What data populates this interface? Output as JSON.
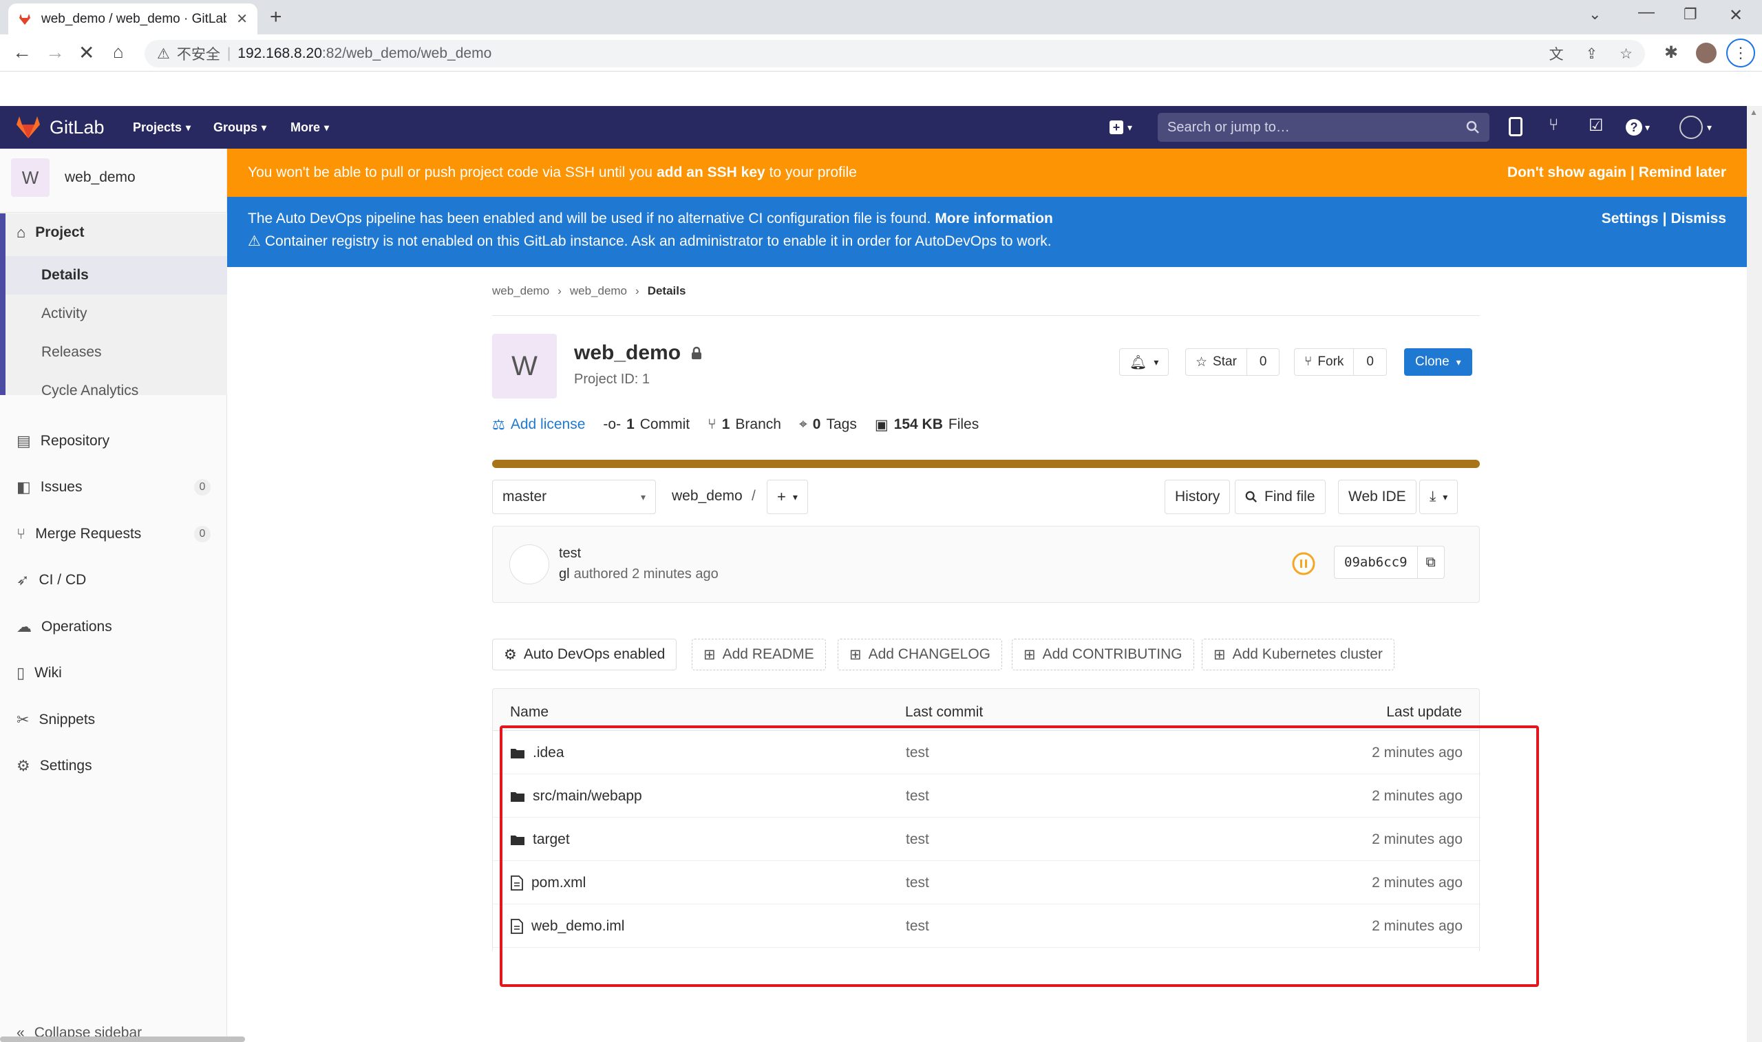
{
  "browser": {
    "tab_title": "web_demo / web_demo · GitLab",
    "security_label": "不安全",
    "url_host": "192.168.8.20",
    "url_rest": ":82/web_demo/web_demo"
  },
  "header": {
    "brand": "GitLab",
    "nav": [
      "Projects",
      "Groups",
      "More"
    ],
    "search_placeholder": "Search or jump to…"
  },
  "sidebar": {
    "project_initial": "W",
    "project_name": "web_demo",
    "section": "Project",
    "sub_items": [
      "Details",
      "Activity",
      "Releases",
      "Cycle Analytics"
    ],
    "items": [
      {
        "label": "Repository"
      },
      {
        "label": "Issues",
        "count": "0"
      },
      {
        "label": "Merge Requests",
        "count": "0"
      },
      {
        "label": "CI / CD"
      },
      {
        "label": "Operations"
      },
      {
        "label": "Wiki"
      },
      {
        "label": "Snippets"
      },
      {
        "label": "Settings"
      }
    ],
    "collapse": "Collapse sidebar"
  },
  "banners": {
    "ssh_text": "You won't be able to pull or push project code via SSH until you",
    "ssh_link": "add an SSH key",
    "ssh_tail": "to your profile",
    "dont_show": "Don't show again",
    "remind": "Remind later",
    "devops_text": "The Auto DevOps pipeline has been enabled and will be used if no alternative CI configuration file is found.",
    "devops_link": "More information",
    "registry_text": "Container registry is not enabled on this GitLab instance. Ask an administrator to enable it in order for AutoDevOps to work.",
    "settings": "Settings",
    "dismiss": "Dismiss"
  },
  "breadcrumb": [
    "web_demo",
    "web_demo",
    "Details"
  ],
  "project": {
    "initial": "W",
    "name": "web_demo",
    "id_label": "Project ID: 1",
    "star_label": "Star",
    "star_count": "0",
    "fork_label": "Fork",
    "fork_count": "0",
    "clone_label": "Clone"
  },
  "stats": {
    "add_license": "Add license",
    "commits_num": "1",
    "commits_label": "Commit",
    "branches_num": "1",
    "branches_label": "Branch",
    "tags_num": "0",
    "tags_label": "Tags",
    "size_num": "154 KB",
    "size_label": "Files"
  },
  "repo": {
    "branch": "master",
    "path": "web_demo",
    "sep": "/",
    "history": "History",
    "find_file": "Find file",
    "web_ide": "Web IDE"
  },
  "commit": {
    "message": "test",
    "author": "gl",
    "authored": "authored 2 minutes ago",
    "sha": "09ab6cc9"
  },
  "actions": [
    "Auto DevOps enabled",
    "Add README",
    "Add CHANGELOG",
    "Add CONTRIBUTING",
    "Add Kubernetes cluster"
  ],
  "table": {
    "headers": [
      "Name",
      "Last commit",
      "Last update"
    ],
    "rows": [
      {
        "name": ".idea",
        "type": "folder",
        "commit": "test",
        "updated": "2 minutes ago"
      },
      {
        "name": "src/main/webapp",
        "type": "folder",
        "commit": "test",
        "updated": "2 minutes ago"
      },
      {
        "name": "target",
        "type": "folder",
        "commit": "test",
        "updated": "2 minutes ago"
      },
      {
        "name": "pom.xml",
        "type": "file",
        "commit": "test",
        "updated": "2 minutes ago"
      },
      {
        "name": "web_demo.iml",
        "type": "file",
        "commit": "test",
        "updated": "2 minutes ago"
      }
    ]
  },
  "colors": {
    "header": "#292961",
    "warning": "#fc9403",
    "info": "#1f78d1",
    "highlight": "#e3161e",
    "pipeline": "#f5a623"
  }
}
